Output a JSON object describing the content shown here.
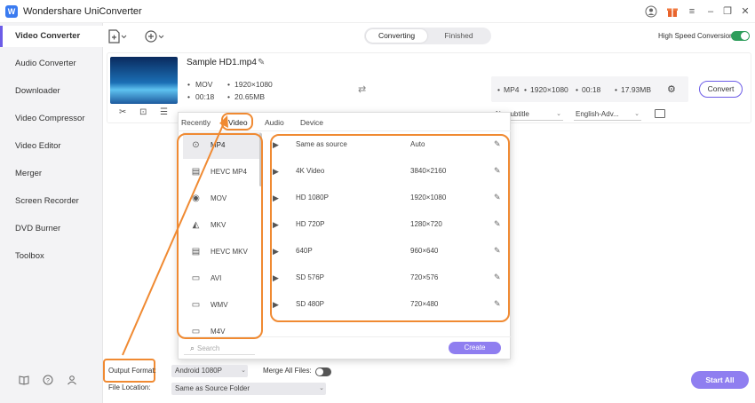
{
  "app": {
    "title": "Wondershare UniConverter",
    "logo_letter": "W"
  },
  "window_icons": {
    "user": "user-icon",
    "gift": "gift-icon",
    "menu": "menu-icon",
    "minimize": "minimize-icon",
    "restore": "restore-icon",
    "close": "close-icon"
  },
  "sidebar": {
    "items": [
      {
        "label": "Video Converter",
        "active": true
      },
      {
        "label": "Audio Converter"
      },
      {
        "label": "Downloader"
      },
      {
        "label": "Video Compressor"
      },
      {
        "label": "Video Editor"
      },
      {
        "label": "Merger"
      },
      {
        "label": "Screen Recorder"
      },
      {
        "label": "DVD Burner"
      },
      {
        "label": "Toolbox"
      }
    ]
  },
  "toolbar": {
    "converting_label": "Converting",
    "finished_label": "Finished",
    "high_speed_label": "High Speed Conversion",
    "high_speed_on": true
  },
  "file": {
    "name": "Sample HD1.mp4",
    "format": "MOV",
    "resolution": "1920×1080",
    "duration": "00:18",
    "size": "20.65MB",
    "output": {
      "format": "MP4",
      "resolution": "1920×1080",
      "duration": "00:18",
      "size": "17.93MB"
    },
    "convert_label": "Convert",
    "subtitle_select": "No subtitle",
    "audio_select": "English-Adv..."
  },
  "popup": {
    "tabs": [
      "Recently",
      "Video",
      "Audio",
      "Device"
    ],
    "active_tab": "Video",
    "formats": [
      "MP4",
      "HEVC MP4",
      "MOV",
      "MKV",
      "HEVC MKV",
      "AVI",
      "WMV",
      "M4V"
    ],
    "selected_format": "MP4",
    "resolutions": [
      {
        "name": "Same as source",
        "value": "Auto"
      },
      {
        "name": "4K Video",
        "value": "3840×2160"
      },
      {
        "name": "HD 1080P",
        "value": "1920×1080"
      },
      {
        "name": "HD 720P",
        "value": "1280×720"
      },
      {
        "name": "640P",
        "value": "960×640"
      },
      {
        "name": "SD 576P",
        "value": "720×576"
      },
      {
        "name": "SD 480P",
        "value": "720×480"
      }
    ],
    "search_placeholder": "Search",
    "create_label": "Create"
  },
  "bottom": {
    "output_format_label": "Output Format:",
    "output_format_value": "Android 1080P",
    "merge_label": "Merge All Files:",
    "merge_on": false,
    "file_location_label": "File Location:",
    "file_location_value": "Same as Source Folder",
    "start_all_label": "Start All"
  },
  "colors": {
    "accent": "#6c5ce7",
    "highlight": "#f08a32",
    "toggle_on": "#2e9d5b"
  }
}
